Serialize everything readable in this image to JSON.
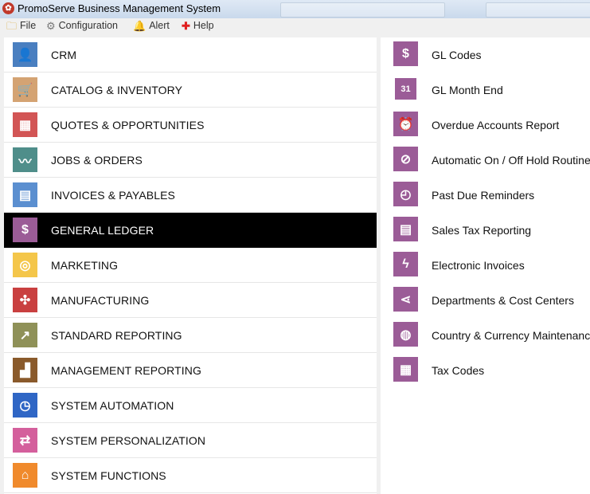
{
  "window": {
    "title": "PromoServe Business Management System"
  },
  "menu": [
    {
      "label": "File",
      "icon": "folder-icon",
      "glyph": "🗀"
    },
    {
      "label": "Configuration",
      "icon": "gear-icon",
      "glyph": "⚙"
    },
    {
      "label": "Alert",
      "icon": "bell-icon",
      "glyph": "🔔"
    },
    {
      "label": "Help",
      "icon": "help-cross-icon",
      "glyph": "✚"
    }
  ],
  "modules": [
    {
      "label": "CRM",
      "icon": "person-icon",
      "glyph": "👤",
      "color": "#4a7fc0"
    },
    {
      "label": "CATALOG & INVENTORY",
      "icon": "cart-icon",
      "glyph": "🛒",
      "color": "#d4a373"
    },
    {
      "label": "QUOTES & OPPORTUNITIES",
      "icon": "calendar-grid-icon",
      "glyph": "▦",
      "color": "#d25555"
    },
    {
      "label": "JOBS & ORDERS",
      "icon": "pulse-icon",
      "glyph": "〰",
      "color": "#4f8e8a"
    },
    {
      "label": "INVOICES & PAYABLES",
      "icon": "calculator-icon",
      "glyph": "▤",
      "color": "#5b8fd0"
    },
    {
      "label": "GENERAL LEDGER",
      "icon": "dollar-icon",
      "glyph": "$",
      "color": "#9b5c97",
      "active": true
    },
    {
      "label": "MARKETING",
      "icon": "globe-icon",
      "glyph": "◎",
      "color": "#f4c64a"
    },
    {
      "label": "MANUFACTURING",
      "icon": "network-icon",
      "glyph": "✣",
      "color": "#c94040"
    },
    {
      "label": "STANDARD REPORTING",
      "icon": "chart-up-icon",
      "glyph": "↗",
      "color": "#8f9158"
    },
    {
      "label": "MANAGEMENT REPORTING",
      "icon": "bar-trend-icon",
      "glyph": "▟",
      "color": "#8a5a2b"
    },
    {
      "label": "SYSTEM AUTOMATION",
      "icon": "stopwatch-icon",
      "glyph": "◷",
      "color": "#2f66c5"
    },
    {
      "label": "SYSTEM PERSONALIZATION",
      "icon": "swap-arrows-icon",
      "glyph": "⇄",
      "color": "#d45f9c"
    },
    {
      "label": "SYSTEM FUNCTIONS",
      "icon": "home-icon",
      "glyph": "⌂",
      "color": "#f08a2c"
    }
  ],
  "ledger_items": [
    {
      "label": "GL Codes",
      "icon": "dollar-icon",
      "glyph": "$"
    },
    {
      "label": "GL Month End",
      "icon": "calendar-31-icon",
      "glyph": "31"
    },
    {
      "label": "Overdue Accounts Report",
      "icon": "alarm-warning-icon",
      "glyph": "⏰"
    },
    {
      "label": "Automatic On / Off Hold Routine",
      "icon": "prohibited-icon",
      "glyph": "⊘"
    },
    {
      "label": "Past Due Reminders",
      "icon": "alarm-clock-icon",
      "glyph": "◴"
    },
    {
      "label": "Sales Tax Reporting",
      "icon": "list-screen-icon",
      "glyph": "▤"
    },
    {
      "label": "Electronic Invoices",
      "icon": "lightning-icon",
      "glyph": "ϟ"
    },
    {
      "label": "Departments & Cost Centers",
      "icon": "share-nodes-icon",
      "glyph": "⋖"
    },
    {
      "label": "Country & Currency Maintenance",
      "icon": "earth-icon",
      "glyph": "◍"
    },
    {
      "label": "Tax Codes",
      "icon": "table-list-icon",
      "glyph": "▦"
    }
  ]
}
